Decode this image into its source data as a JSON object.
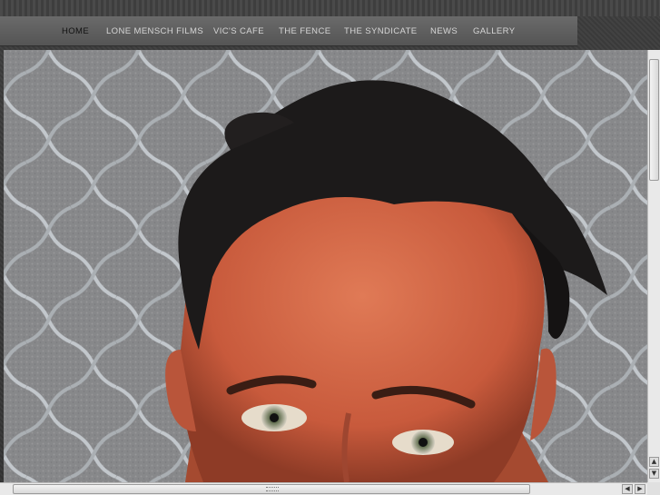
{
  "nav": {
    "items": [
      {
        "label": "HOME",
        "active": true
      },
      {
        "label": "LONE MENSCH FILMS",
        "active": false
      },
      {
        "label": "VIC'S CAFE",
        "active": false
      },
      {
        "label": "THE FENCE",
        "active": false
      },
      {
        "label": "THE SYNDICATE",
        "active": false
      },
      {
        "label": "NEWS",
        "active": false
      },
      {
        "label": "GALLERY",
        "active": false
      }
    ]
  },
  "colors": {
    "nav_bg": "#5f5f5f",
    "nav_text": "#d6d6d6",
    "nav_active_text": "#111111",
    "page_bg": "#3a3a3a"
  },
  "hero": {
    "icon": "portrait-photo"
  },
  "scrollbar_icons": {
    "up": "arrow-up-icon",
    "down": "arrow-down-icon",
    "left": "arrow-left-icon",
    "right": "arrow-right-icon"
  }
}
